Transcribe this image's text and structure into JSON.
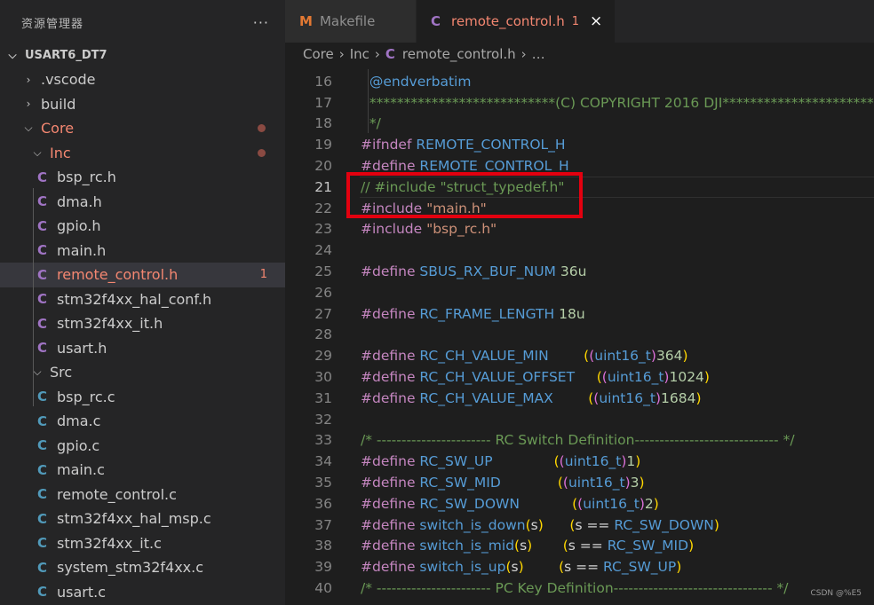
{
  "explorer": {
    "title": "资源管理器",
    "more": "···",
    "root": "USART6_DT7",
    "items": [
      {
        "label": ".vscode"
      },
      {
        "label": "build"
      },
      {
        "label": "Core"
      },
      {
        "label": "Inc"
      },
      {
        "label": "bsp_rc.h"
      },
      {
        "label": "dma.h"
      },
      {
        "label": "gpio.h"
      },
      {
        "label": "main.h"
      },
      {
        "label": "remote_control.h",
        "badge": "1"
      },
      {
        "label": "stm32f4xx_hal_conf.h"
      },
      {
        "label": "stm32f4xx_it.h"
      },
      {
        "label": "usart.h"
      },
      {
        "label": "Src"
      },
      {
        "label": "bsp_rc.c"
      },
      {
        "label": "dma.c"
      },
      {
        "label": "gpio.c"
      },
      {
        "label": "main.c"
      },
      {
        "label": "remote_control.c"
      },
      {
        "label": "stm32f4xx_hal_msp.c"
      },
      {
        "label": "stm32f4xx_it.c"
      },
      {
        "label": "system_stm32f4xx.c"
      },
      {
        "label": "usart.c"
      }
    ],
    "icon_letter_m": "M",
    "icon_letter_c": "C"
  },
  "tabs": [
    {
      "label": "Makefile"
    },
    {
      "label": "remote_control.h",
      "badge": "1",
      "close": "×"
    }
  ],
  "breadcrumb": {
    "parts": [
      "Core",
      "Inc",
      "remote_control.h",
      "…"
    ],
    "sep": "›"
  },
  "editor": {
    "lines": [
      {
        "n": "16",
        "segs": [
          [
            "  ",
            "plain"
          ],
          [
            "@endverbatim",
            "mac"
          ]
        ]
      },
      {
        "n": "17",
        "segs": [
          [
            "  ***************************(C) COPYRIGHT 2016 DJI*****************************",
            "com"
          ]
        ]
      },
      {
        "n": "18",
        "segs": [
          [
            "  */",
            "com"
          ]
        ]
      },
      {
        "n": "19",
        "segs": [
          [
            "#ifndef ",
            "kw"
          ],
          [
            "REMOTE_CONTROL_H",
            "mac"
          ]
        ]
      },
      {
        "n": "20",
        "segs": [
          [
            "#define ",
            "kw"
          ],
          [
            "REMOTE_CONTROL_H",
            "mac"
          ]
        ]
      },
      {
        "n": "21",
        "segs": [
          [
            "// #include \"struct_typedef.h\"",
            "com"
          ]
        ]
      },
      {
        "n": "22",
        "segs": [
          [
            "#include ",
            "kw"
          ],
          [
            "\"main.h\"",
            "str"
          ]
        ]
      },
      {
        "n": "23",
        "segs": [
          [
            "#include ",
            "kw"
          ],
          [
            "\"bsp_rc.h\"",
            "str"
          ]
        ]
      },
      {
        "n": "24",
        "segs": []
      },
      {
        "n": "25",
        "segs": [
          [
            "#define ",
            "kw"
          ],
          [
            "SBUS_RX_BUF_NUM ",
            "mac"
          ],
          [
            "36u",
            "num"
          ]
        ]
      },
      {
        "n": "26",
        "segs": []
      },
      {
        "n": "27",
        "segs": [
          [
            "#define ",
            "kw"
          ],
          [
            "RC_FRAME_LENGTH ",
            "mac"
          ],
          [
            "18u",
            "num"
          ]
        ]
      },
      {
        "n": "28",
        "segs": []
      },
      {
        "n": "29",
        "segs": [
          [
            "#define ",
            "kw"
          ],
          [
            "RC_CH_VALUE_MIN",
            "mac"
          ],
          [
            "        ",
            "plain"
          ],
          [
            "(",
            "p1"
          ],
          [
            "(",
            "p2"
          ],
          [
            "uint16_t",
            "mac"
          ],
          [
            ")",
            "p2"
          ],
          [
            "364",
            "num"
          ],
          [
            ")",
            "p1"
          ]
        ]
      },
      {
        "n": "30",
        "segs": [
          [
            "#define ",
            "kw"
          ],
          [
            "RC_CH_VALUE_OFFSET",
            "mac"
          ],
          [
            "     ",
            "plain"
          ],
          [
            "(",
            "p1"
          ],
          [
            "(",
            "p2"
          ],
          [
            "uint16_t",
            "mac"
          ],
          [
            ")",
            "p2"
          ],
          [
            "1024",
            "num"
          ],
          [
            ")",
            "p1"
          ]
        ]
      },
      {
        "n": "31",
        "segs": [
          [
            "#define ",
            "kw"
          ],
          [
            "RC_CH_VALUE_MAX",
            "mac"
          ],
          [
            "        ",
            "plain"
          ],
          [
            "(",
            "p1"
          ],
          [
            "(",
            "p2"
          ],
          [
            "uint16_t",
            "mac"
          ],
          [
            ")",
            "p2"
          ],
          [
            "1684",
            "num"
          ],
          [
            ")",
            "p1"
          ]
        ]
      },
      {
        "n": "32",
        "segs": []
      },
      {
        "n": "33",
        "segs": [
          [
            "/* ----------------------- RC Switch Definition----------------------------- */",
            "com"
          ]
        ]
      },
      {
        "n": "34",
        "segs": [
          [
            "#define ",
            "kw"
          ],
          [
            "RC_SW_UP",
            "mac"
          ],
          [
            "              ",
            "plain"
          ],
          [
            "(",
            "p1"
          ],
          [
            "(",
            "p2"
          ],
          [
            "uint16_t",
            "mac"
          ],
          [
            ")",
            "p2"
          ],
          [
            "1",
            "num"
          ],
          [
            ")",
            "p1"
          ]
        ]
      },
      {
        "n": "35",
        "segs": [
          [
            "#define ",
            "kw"
          ],
          [
            "RC_SW_MID",
            "mac"
          ],
          [
            "             ",
            "plain"
          ],
          [
            "(",
            "p1"
          ],
          [
            "(",
            "p2"
          ],
          [
            "uint16_t",
            "mac"
          ],
          [
            ")",
            "p2"
          ],
          [
            "3",
            "num"
          ],
          [
            ")",
            "p1"
          ]
        ]
      },
      {
        "n": "36",
        "segs": [
          [
            "#define ",
            "kw"
          ],
          [
            "RC_SW_DOWN",
            "mac"
          ],
          [
            "            ",
            "plain"
          ],
          [
            "(",
            "p1"
          ],
          [
            "(",
            "p2"
          ],
          [
            "uint16_t",
            "mac"
          ],
          [
            ")",
            "p2"
          ],
          [
            "2",
            "num"
          ],
          [
            ")",
            "p1"
          ]
        ]
      },
      {
        "n": "37",
        "segs": [
          [
            "#define ",
            "kw"
          ],
          [
            "switch_is_down",
            "mac"
          ],
          [
            "(",
            "p1"
          ],
          [
            "s",
            "plain"
          ],
          [
            ")",
            "p1"
          ],
          [
            "      ",
            "plain"
          ],
          [
            "(",
            "p1"
          ],
          [
            "s == ",
            "plain"
          ],
          [
            "RC_SW_DOWN",
            "mac"
          ],
          [
            ")",
            "p1"
          ]
        ]
      },
      {
        "n": "38",
        "segs": [
          [
            "#define ",
            "kw"
          ],
          [
            "switch_is_mid",
            "mac"
          ],
          [
            "(",
            "p1"
          ],
          [
            "s",
            "plain"
          ],
          [
            ")",
            "p1"
          ],
          [
            "       ",
            "plain"
          ],
          [
            "(",
            "p1"
          ],
          [
            "s == ",
            "plain"
          ],
          [
            "RC_SW_MID",
            "mac"
          ],
          [
            ")",
            "p1"
          ]
        ]
      },
      {
        "n": "39",
        "segs": [
          [
            "#define ",
            "kw"
          ],
          [
            "switch_is_up",
            "mac"
          ],
          [
            "(",
            "p1"
          ],
          [
            "s",
            "plain"
          ],
          [
            ")",
            "p1"
          ],
          [
            "        ",
            "plain"
          ],
          [
            "(",
            "p1"
          ],
          [
            "s == ",
            "plain"
          ],
          [
            "RC_SW_UP",
            "mac"
          ],
          [
            ")",
            "p1"
          ]
        ]
      },
      {
        "n": "40",
        "segs": [
          [
            "/* ----------------------- PC Key Definition-------------------------------- */",
            "com"
          ]
        ]
      }
    ]
  },
  "watermark": "CSDN @%E5",
  "colors": {
    "highlight_box": "#e3000f",
    "modified": "#f48771",
    "c_header_icon": "#a074c4",
    "c_source_icon": "#519aba",
    "makefile_icon": "#e37933"
  }
}
